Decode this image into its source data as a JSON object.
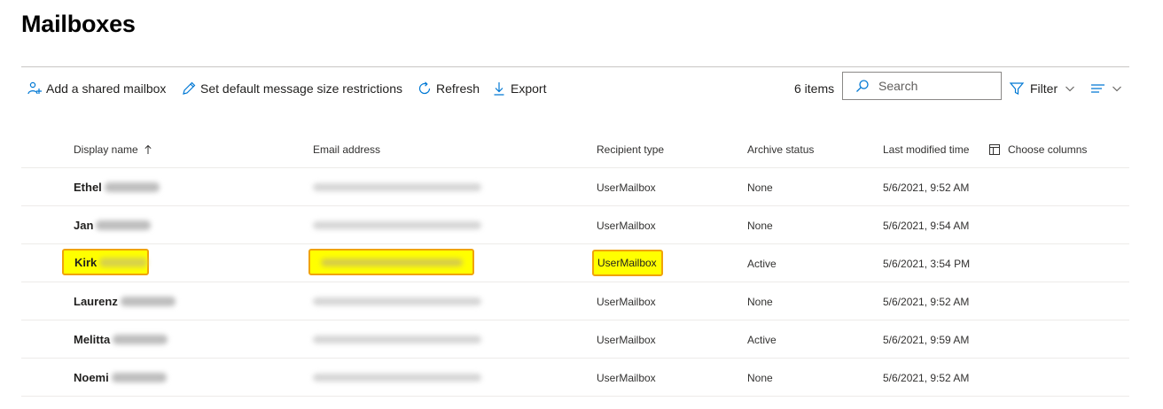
{
  "page": {
    "title": "Mailboxes"
  },
  "toolbar": {
    "add_shared": {
      "label": "Add a shared mailbox",
      "icon": "add-people-icon"
    },
    "set_default": {
      "label": "Set default message size restrictions",
      "icon": "pencil-icon"
    },
    "refresh": {
      "label": "Refresh",
      "icon": "refresh-icon"
    },
    "export": {
      "label": "Export",
      "icon": "download-icon"
    },
    "items_count": "6 items",
    "search": {
      "placeholder": "Search",
      "value": "",
      "icon": "search-icon"
    },
    "filter": {
      "label": "Filter",
      "icon": "filter-icon"
    },
    "view": {
      "icon": "list-view-icon"
    }
  },
  "table": {
    "columns": {
      "display_name": "Display name",
      "email": "Email address",
      "recipient_type": "Recipient type",
      "archive_status": "Archive status",
      "last_modified": "Last modified time",
      "choose_columns": "Choose columns"
    },
    "sort": {
      "column": "display_name",
      "direction": "ascending",
      "icon": "sort-up-arrow-icon"
    },
    "rows": [
      {
        "first_name": "Ethel",
        "recipient_type": "UserMailbox",
        "archive_status": "None",
        "last_modified": "5/6/2021, 9:52 AM",
        "highlighted": false
      },
      {
        "first_name": "Jan",
        "recipient_type": "UserMailbox",
        "archive_status": "None",
        "last_modified": "5/6/2021, 9:54 AM",
        "highlighted": false
      },
      {
        "first_name": "Kirk",
        "recipient_type": "UserMailbox",
        "archive_status": "Active",
        "last_modified": "5/6/2021, 3:54 PM",
        "highlighted": true
      },
      {
        "first_name": "Laurenz",
        "recipient_type": "UserMailbox",
        "archive_status": "None",
        "last_modified": "5/6/2021, 9:52 AM",
        "highlighted": false
      },
      {
        "first_name": "Melitta",
        "recipient_type": "UserMailbox",
        "archive_status": "Active",
        "last_modified": "5/6/2021, 9:59 AM",
        "highlighted": false
      },
      {
        "first_name": "Noemi",
        "recipient_type": "UserMailbox",
        "archive_status": "None",
        "last_modified": "5/6/2021, 9:52 AM",
        "highlighted": false
      }
    ]
  },
  "colors": {
    "accent": "#0078d4",
    "highlight_fill": "#ffff00",
    "highlight_border": "#f0a30a"
  }
}
